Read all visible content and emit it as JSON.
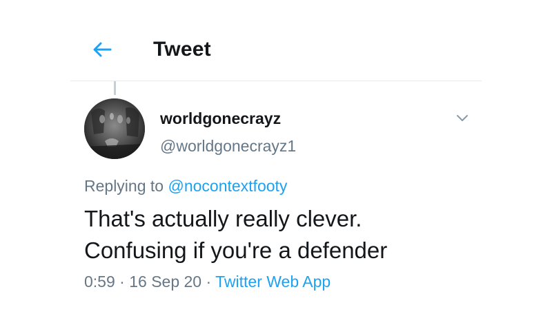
{
  "header": {
    "back_icon": "arrow-left-icon",
    "title": "Tweet"
  },
  "colors": {
    "accent": "#1da1f2",
    "text_primary": "#14171a",
    "text_secondary": "#657786",
    "divider": "#e6ecf0"
  },
  "tweet": {
    "author": {
      "display_name": "worldgonecrayz",
      "handle": "@worldgonecrayz1",
      "avatar_icon": "avatar-image"
    },
    "menu_icon": "chevron-down-icon",
    "replying_to_label": "Replying to",
    "replying_to_handle": "@nocontextfooty",
    "text_line1": "That's actually really clever.",
    "text_line2": "Confusing if you're a defender",
    "time": "0:59",
    "separator": " · ",
    "date": "16 Sep 20",
    "source": "Twitter Web App"
  }
}
